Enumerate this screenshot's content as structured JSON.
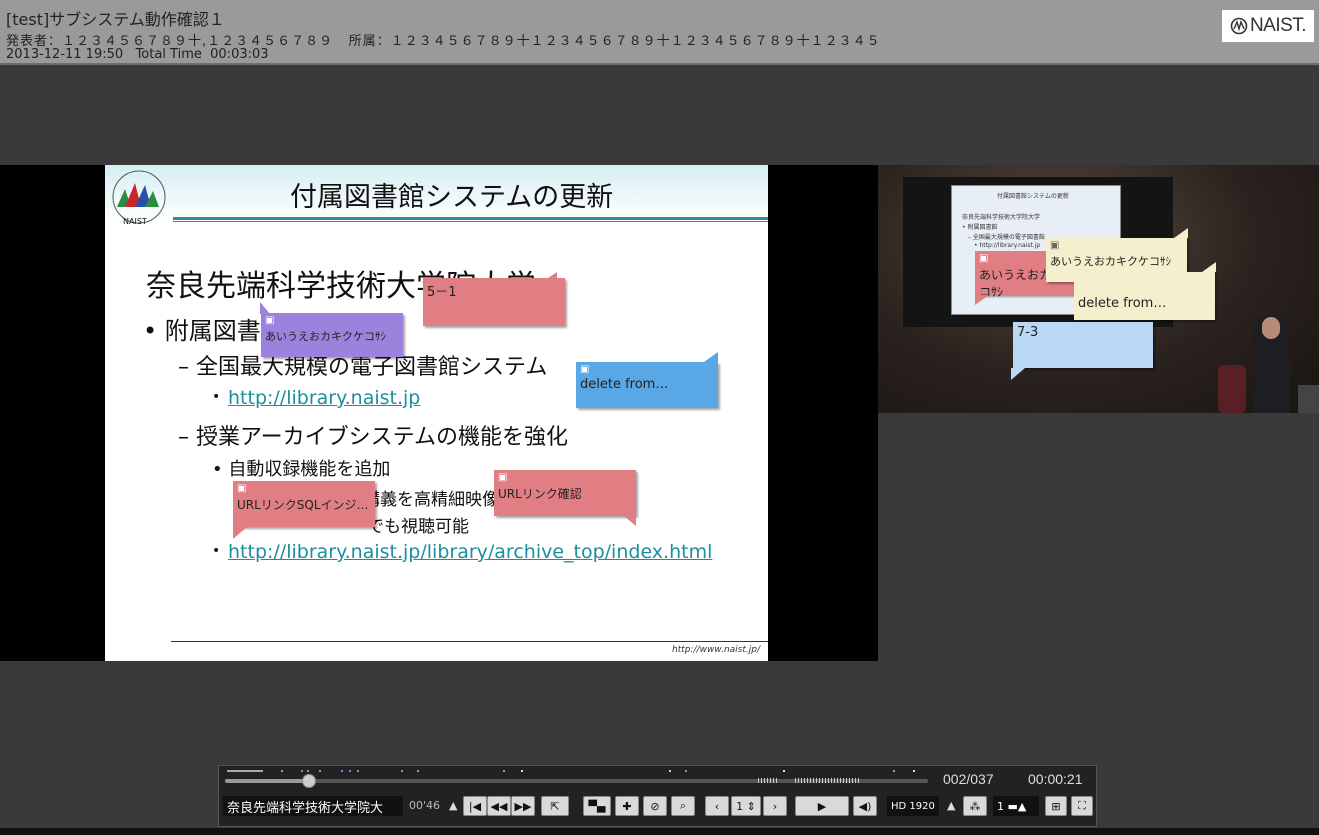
{
  "header": {
    "title": "[test]サブシステム動作確認１",
    "presenter_label": "発表者：",
    "presenter_value": "１２３４５６７８９十,１２３４５６７８９",
    "affiliation_label": "所属：",
    "affiliation_value": "１２３４５６７８９十１２３４５６７８９十１２３４５６７８９十１２３４５",
    "datetime": "2013-12-11  19:50",
    "total_time_label": "Total Time",
    "total_time": "00:03:03",
    "logo_text": "NAIST."
  },
  "slide": {
    "title": "付属図書館システムの更新",
    "emblem_text": "NAIST",
    "lines": {
      "l1": "奈良先端科学技術大学院大学",
      "l2": "• 附属図書館",
      "l3": "– 全国最大規模の電子図書館システム",
      "l4": "http://library.naist.jp",
      "l5": "– 授業アーカイブシステムの機能を強化",
      "l6": "• 自動収録機能を追加",
      "l7": "講義を高精細映像",
      "l8": "でも視聴可能",
      "l9": "http://library.naist.jp/library/archive_top/index.html"
    },
    "footer_url": "http://www.naist.jp/"
  },
  "slide_notes": {
    "n1": "5－1",
    "n2": "あいうえおカキクケコｻｼ",
    "n3": "delete from…",
    "n4": "URLリンクSQLインジ…",
    "n5": "URLリンク確認"
  },
  "video": {
    "screen_title": "付属図書館システムの更新",
    "screen_l1": "奈良先端科学技術大学院大学",
    "screen_l2": "• 附属図書館",
    "screen_l3": "– 全国最大規模の電子図書館",
    "screen_l4": "• http://library.naist.jp",
    "notes": {
      "v1": "あいうえおカキクケコｻｼ",
      "v2": "あいうえおカキクケコｻｼ",
      "v3": "delete from…",
      "v4": "7-3"
    }
  },
  "player": {
    "counter": "002/037",
    "clock": "00:00:21",
    "chapter_title": "奈良先端科学技術大学院大",
    "chapter_time": "00'46",
    "page": "1",
    "quality": "HD 1920",
    "speed": "1"
  },
  "colors": {
    "note_red": "#e17e84",
    "note_purple": "#9c82dd",
    "note_blue": "#5aa7e6",
    "note_light_blue": "#b9d8f5",
    "note_cream": "#f4efcd",
    "link": "#1b8fa0"
  },
  "icons": [
    "annotation-icon",
    "first-icon",
    "rewind-icon",
    "fast-forward-icon",
    "export-icon",
    "comments-icon",
    "add-comment-icon",
    "hide-comment-icon",
    "search-icon",
    "prev-icon",
    "next-icon",
    "play-icon",
    "volume-icon",
    "quality-icon",
    "share-icon",
    "speed-icon",
    "layout-icon",
    "fullscreen-icon"
  ]
}
